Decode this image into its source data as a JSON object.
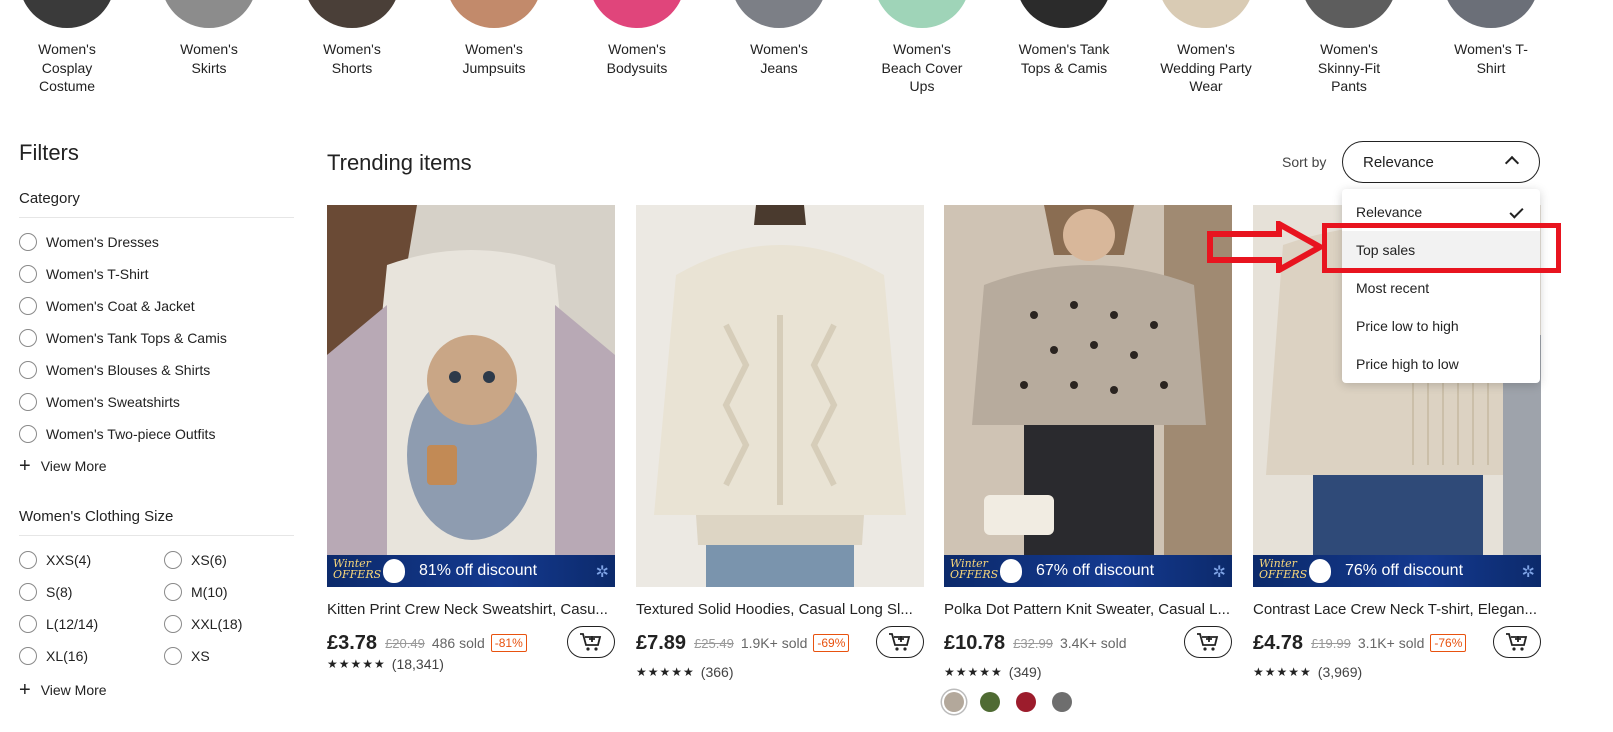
{
  "categories": [
    {
      "label": "Women's Cosplay Costume",
      "color": "#3a3a3a"
    },
    {
      "label": "Women's Skirts",
      "color": "#8c8c8c"
    },
    {
      "label": "Women's Shorts",
      "color": "#4a3f38"
    },
    {
      "label": "Women's Jumpsuits",
      "color": "#c28a6b"
    },
    {
      "label": "Women's Bodysuits",
      "color": "#e0457b"
    },
    {
      "label": "Women's Jeans",
      "color": "#7c7f86"
    },
    {
      "label": "Women's Beach Cover Ups",
      "color": "#9fd4b8"
    },
    {
      "label": "Women's Tank Tops & Camis",
      "color": "#2b2b2b"
    },
    {
      "label": "Women's Wedding Party Wear",
      "color": "#d9cbb4"
    },
    {
      "label": "Women's Skinny-Fit Pants",
      "color": "#5d5d5d"
    },
    {
      "label": "Women's T-Shirt",
      "color": "#6b6f78"
    }
  ],
  "filters": {
    "title": "Filters",
    "category": {
      "title": "Category",
      "items": [
        "Women's Dresses",
        "Women's T-Shirt",
        "Women's Coat & Jacket",
        "Women's Tank Tops & Camis",
        "Women's Blouses & Shirts",
        "Women's Sweatshirts",
        "Women's Two-piece Outfits"
      ],
      "view_more": "View More"
    },
    "size": {
      "title": "Women's Clothing Size",
      "items": [
        "XXS(4)",
        "XS(6)",
        "S(8)",
        "M(10)",
        "L(12/14)",
        "XXL(18)",
        "XL(16)",
        "XS"
      ],
      "view_more": "View More"
    }
  },
  "main": {
    "title": "Trending items",
    "sort_label": "Sort by",
    "sort_value": "Relevance",
    "sort_options": [
      "Relevance",
      "Top sales",
      "Most recent",
      "Price low to high",
      "Price high to low"
    ]
  },
  "products": [
    {
      "title": "Kitten Print Crew Neck Sweatshirt, Casu...",
      "price": "£3.78",
      "orig": "£20.49",
      "sold": "486 sold",
      "discount": "-81%",
      "banner": "81% off discount",
      "reviews": "(18,341)",
      "stars": "★★★★★",
      "img_color": "#d6d1c8"
    },
    {
      "title": "Textured Solid Hoodies, Casual Long Sl...",
      "price": "£7.89",
      "orig": "£25.49",
      "sold": "1.9K+ sold",
      "discount": "-69%",
      "banner": "",
      "reviews": "(366)",
      "stars": "★★★★★",
      "img_color": "#ece7dc"
    },
    {
      "title": "Polka Dot Pattern Knit Sweater, Casual L...",
      "price": "£10.78",
      "orig": "£32.99",
      "sold": "3.4K+ sold",
      "discount": "",
      "banner": "67% off discount",
      "reviews": "(349)",
      "stars": "★★★★★",
      "img_color": "#b8aea2",
      "swatches": [
        "#b3a89b",
        "#4f6b33",
        "#9c1c2c",
        "#6e6e6e"
      ]
    },
    {
      "title": "Contrast Lace Crew Neck T-shirt, Elegan...",
      "price": "£4.78",
      "orig": "£19.99",
      "sold": "3.1K+ sold",
      "discount": "-76%",
      "banner": "76% off discount",
      "reviews": "(3,969)",
      "stars": "★★★★★",
      "img_color": "#d9d0c3"
    }
  ],
  "banner_brand": "Winter OFFERS",
  "annotation_color": "#e8141f"
}
